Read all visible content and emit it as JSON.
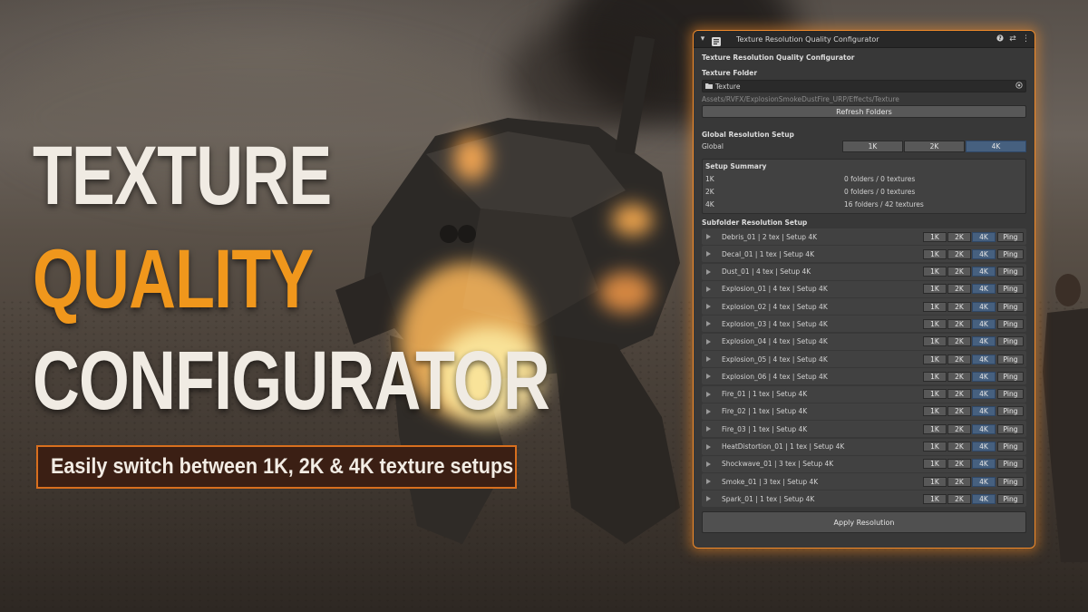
{
  "hero": {
    "line1": "TEXTURE",
    "line2": "QUALITY",
    "line3": "CONFIGURATOR",
    "subtitle": "Easily switch between 1K, 2K & 4K texture setups",
    "colors": {
      "title": "#f0ebe3",
      "accent": "#f0971c",
      "box_border": "#d86f1e"
    }
  },
  "window": {
    "tab_title": "Texture Resolution Quality Configurator",
    "header_icons": [
      "help-icon",
      "options-icon",
      "more-icon"
    ],
    "heading": "Texture Resolution Quality Configurator",
    "texture_folder": {
      "label": "Texture Folder",
      "value": "Texture",
      "path": "Assets/RVFX/ExplosionSmokeDustFire_URP/Effects/Texture"
    },
    "refresh_label": "Refresh Folders",
    "global": {
      "section_label": "Global Resolution Setup",
      "row_label": "Global",
      "options": [
        "1K",
        "2K",
        "4K"
      ],
      "selected": "4K"
    },
    "summary": {
      "title": "Setup Summary",
      "rows": [
        {
          "res": "1K",
          "value": "0 folders / 0 textures"
        },
        {
          "res": "2K",
          "value": "0 folders / 0 textures"
        },
        {
          "res": "4K",
          "value": "16 folders / 42 textures"
        }
      ]
    },
    "subfolder_label": "Subfolder Resolution Setup",
    "options": [
      "1K",
      "2K",
      "4K"
    ],
    "ping_label": "Ping",
    "subfolders": [
      {
        "label": "Debris_01  |  2 tex  |  Setup 4K",
        "selected": "4K"
      },
      {
        "label": "Decal_01  |  1 tex  |  Setup 4K",
        "selected": "4K"
      },
      {
        "label": "Dust_01  |  4 tex  |  Setup 4K",
        "selected": "4K"
      },
      {
        "label": "Explosion_01  |  4 tex  |  Setup 4K",
        "selected": "4K"
      },
      {
        "label": "Explosion_02  |  4 tex  |  Setup 4K",
        "selected": "4K"
      },
      {
        "label": "Explosion_03  |  4 tex  |  Setup 4K",
        "selected": "4K"
      },
      {
        "label": "Explosion_04  |  4 tex  |  Setup 4K",
        "selected": "4K"
      },
      {
        "label": "Explosion_05  |  4 tex  |  Setup 4K",
        "selected": "4K"
      },
      {
        "label": "Explosion_06  |  4 tex  |  Setup 4K",
        "selected": "4K"
      },
      {
        "label": "Fire_01  |  1 tex  |  Setup 4K",
        "selected": "4K"
      },
      {
        "label": "Fire_02  |  1 tex  |  Setup 4K",
        "selected": "4K"
      },
      {
        "label": "Fire_03  |  1 tex  |  Setup 4K",
        "selected": "4K"
      },
      {
        "label": "HeatDistortion_01  |  1 tex  |  Setup 4K",
        "selected": "4K"
      },
      {
        "label": "Shockwave_01  |  3 tex  |  Setup 4K",
        "selected": "4K"
      },
      {
        "label": "Smoke_01  |  3 tex  |  Setup 4K",
        "selected": "4K"
      },
      {
        "label": "Spark_01  |  1 tex  |  Setup 4K",
        "selected": "4K"
      }
    ],
    "apply_label": "Apply Resolution",
    "colors": {
      "border_glow": "#f08a2a",
      "panel": "#383838",
      "selected_button": "#46607f"
    }
  }
}
